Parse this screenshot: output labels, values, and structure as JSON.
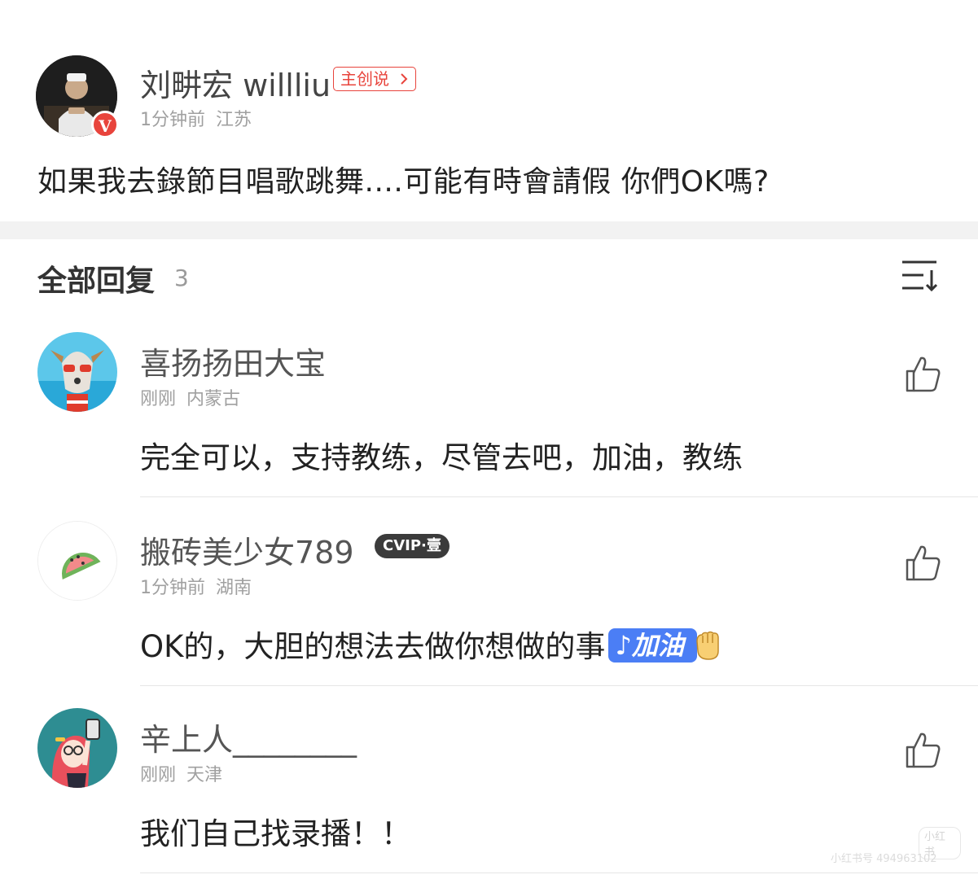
{
  "post": {
    "author": "刘畊宏 willliu",
    "tag": "主创说",
    "time": "1分钟前",
    "location": "江苏",
    "verified_badge": "V",
    "text": "如果我去錄節目唱歌跳舞....可能有時會請假 你們OK嗎?"
  },
  "replies": {
    "title": "全部回复",
    "count": "3"
  },
  "comments": [
    {
      "name": "喜扬扬田大宝",
      "time": "刚刚",
      "location": "内蒙古",
      "text": "完全可以，支持教练，尽管去吧，加油，教练"
    },
    {
      "name": "搬砖美少女789",
      "badge": "CVIP·壹",
      "time": "1分钟前",
      "location": "湖南",
      "text": "OK的，大胆的想法去做你想做的事",
      "emoji_text": "♪加油"
    },
    {
      "name": "辛上人________",
      "time": "刚刚",
      "location": "天津",
      "text": "我们自己找录播！！"
    }
  ],
  "watermark": {
    "logo": "小红书",
    "text": "小红书号 494963102"
  },
  "colors": {
    "accent_red": "#e8443c",
    "emoji_blue": "#4b7ef5",
    "meta_gray": "#a0a0a0"
  },
  "icons": [
    "sort-icon",
    "thumbs-up-icon",
    "fist-icon",
    "verified-icon"
  ]
}
